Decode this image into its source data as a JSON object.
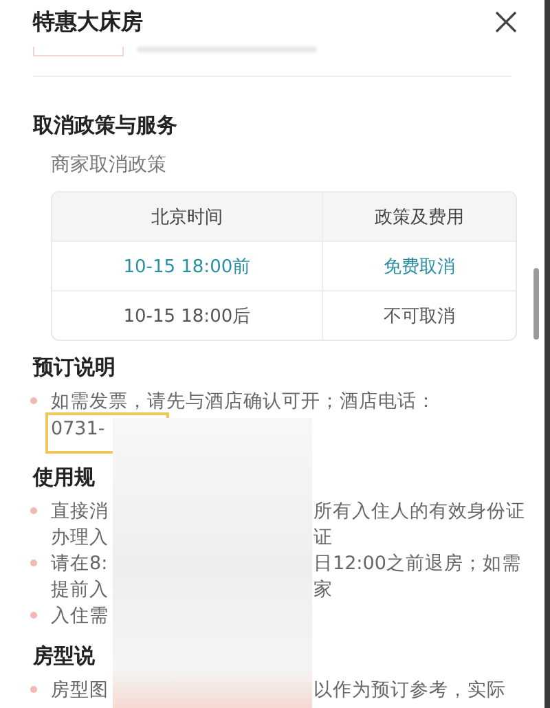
{
  "header": {
    "title": "特惠大床房"
  },
  "cancel_section": {
    "title": "取消政策与服务",
    "subtitle": "商家取消政策",
    "table": {
      "columns": [
        "北京时间",
        "政策及费用"
      ],
      "rows": [
        {
          "cells": [
            "10-15 18:00前",
            "免费取消"
          ],
          "highlighted": true
        },
        {
          "cells": [
            "10-15 18:00后",
            "不可取消"
          ],
          "highlighted": false
        }
      ]
    }
  },
  "sections": [
    {
      "title": "预订说明",
      "items": [
        {
          "lines": [
            {
              "left": "如需发票，请先与酒店确认可开；酒店电话："
            },
            {
              "left": "0731-",
              "annotated": true
            }
          ]
        }
      ]
    },
    {
      "title": "使用规",
      "items": [
        {
          "lines": [
            {
              "left": "直接消",
              "right": "所有入住人的有效身份证"
            },
            {
              "left": "办理入",
              "right": "证"
            }
          ]
        },
        {
          "lines": [
            {
              "left": "请在8:",
              "right": "日12:00之前退房；如需"
            },
            {
              "left": "提前入",
              "right": "家"
            }
          ]
        },
        {
          "lines": [
            {
              "left": "入住需"
            }
          ]
        }
      ]
    },
    {
      "title": "房型说",
      "items": [
        {
          "lines": [
            {
              "left": "房型图",
              "right": "以作为预订参考，实际"
            }
          ]
        }
      ]
    }
  ]
}
